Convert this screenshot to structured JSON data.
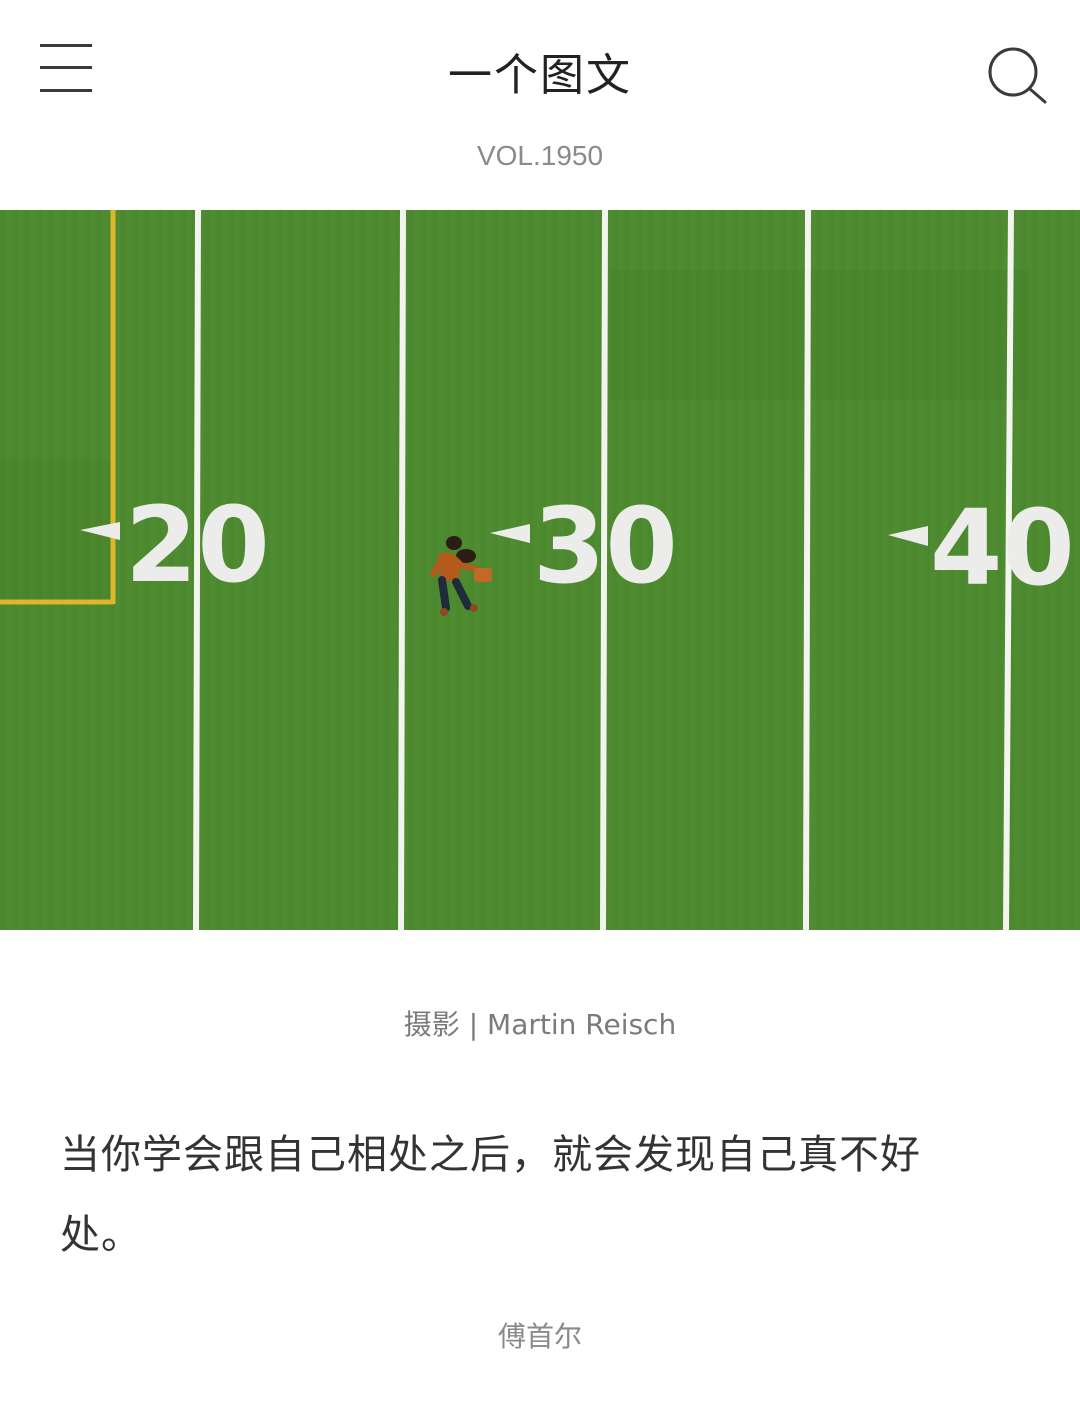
{
  "header": {
    "title": "一个图文",
    "menu_icon": "hamburger-menu-icon",
    "search_icon": "search-icon"
  },
  "volume": "VOL.1950",
  "photo": {
    "yard_numbers": [
      "20",
      "30",
      "40"
    ],
    "colors": {
      "turf": "#4e8a2e",
      "lines": "#f4f4f0",
      "goal_line": "#e2b62a"
    }
  },
  "credit": "摄影 | Martin Reisch",
  "quote": "当你学会跟自己相处之后，就会发现自己真不好处。",
  "author": "傅首尔"
}
